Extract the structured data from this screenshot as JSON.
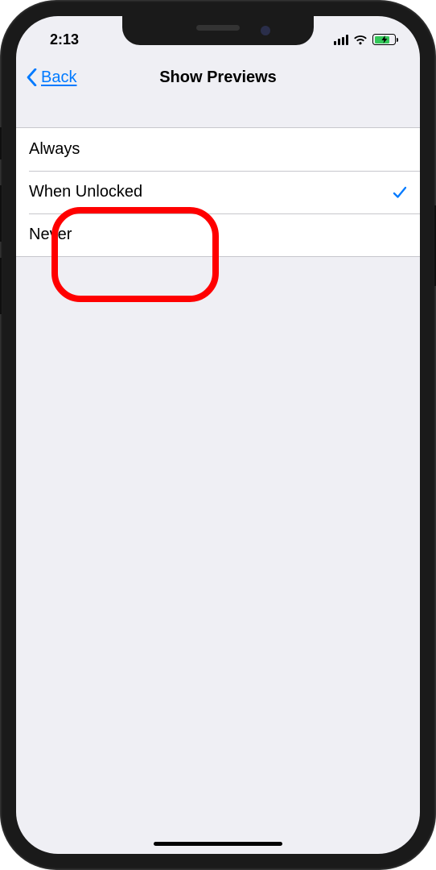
{
  "status": {
    "time": "2:13"
  },
  "nav": {
    "back_label": "Back",
    "title": "Show Previews"
  },
  "options": [
    {
      "label": "Always",
      "selected": false
    },
    {
      "label": "When Unlocked",
      "selected": true
    },
    {
      "label": "Never",
      "selected": false
    }
  ]
}
